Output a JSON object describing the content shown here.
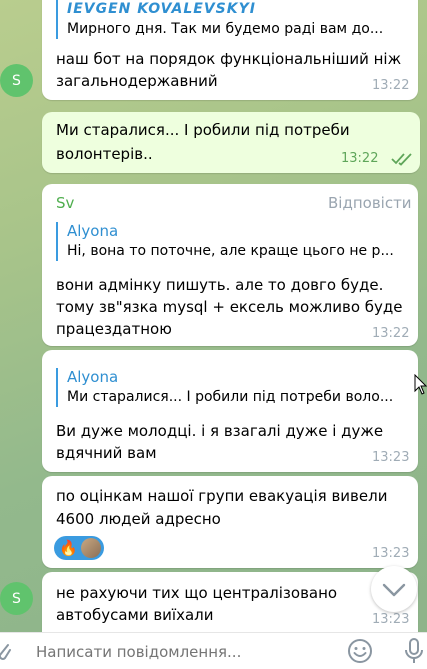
{
  "messages": {
    "m1": {
      "reply_name": "IEVGEN KOVALEVSKYI",
      "reply_text": "Мирного дня.  Так ми будемо раді вам до...",
      "lines": [
        "наш бот на порядок функціональніший ніж",
        "загальнодержавний"
      ],
      "time": "13:22",
      "avatar_letter": "S"
    },
    "m2": {
      "lines": [
        "Ми старалися... І робили під потреби",
        "волонтерів.."
      ],
      "time": "13:22"
    },
    "m3": {
      "sender": "Sv",
      "reply_action": "Відповісти",
      "reply_name": "Alyona",
      "reply_text": "Ні, вона то поточне, але краще цього не р...",
      "lines": [
        "вони адмінку пишуть. але то довго буде.",
        "тому зв\"язка mysql + ексель можливо буде",
        "працездатною"
      ],
      "time": "13:22"
    },
    "m4": {
      "reply_name": "Alyona",
      "reply_text": "Ми старалися... І робили під потреби воло...",
      "lines": [
        "Ви дуже молодці. і я взагалі дуже і дуже",
        "вдячний вам"
      ],
      "time": "13:23"
    },
    "m5": {
      "lines": [
        "по оцінкам нашої групи евакуація вивели",
        "4600 людей адресно"
      ],
      "reaction_emoji": "🔥",
      "time": "13:23"
    },
    "m6": {
      "lines": [
        "не рахуючи тих що централізовано",
        "автобусами виїхали"
      ],
      "time": "13:23",
      "avatar_letter": "S"
    }
  },
  "composer": {
    "placeholder": "Написати повідомлення..."
  },
  "colors": {
    "accent": "#3a9be0",
    "sender": "#4fae4e",
    "outgoing_bg": "#eeffde",
    "check": "#5fa65a"
  }
}
